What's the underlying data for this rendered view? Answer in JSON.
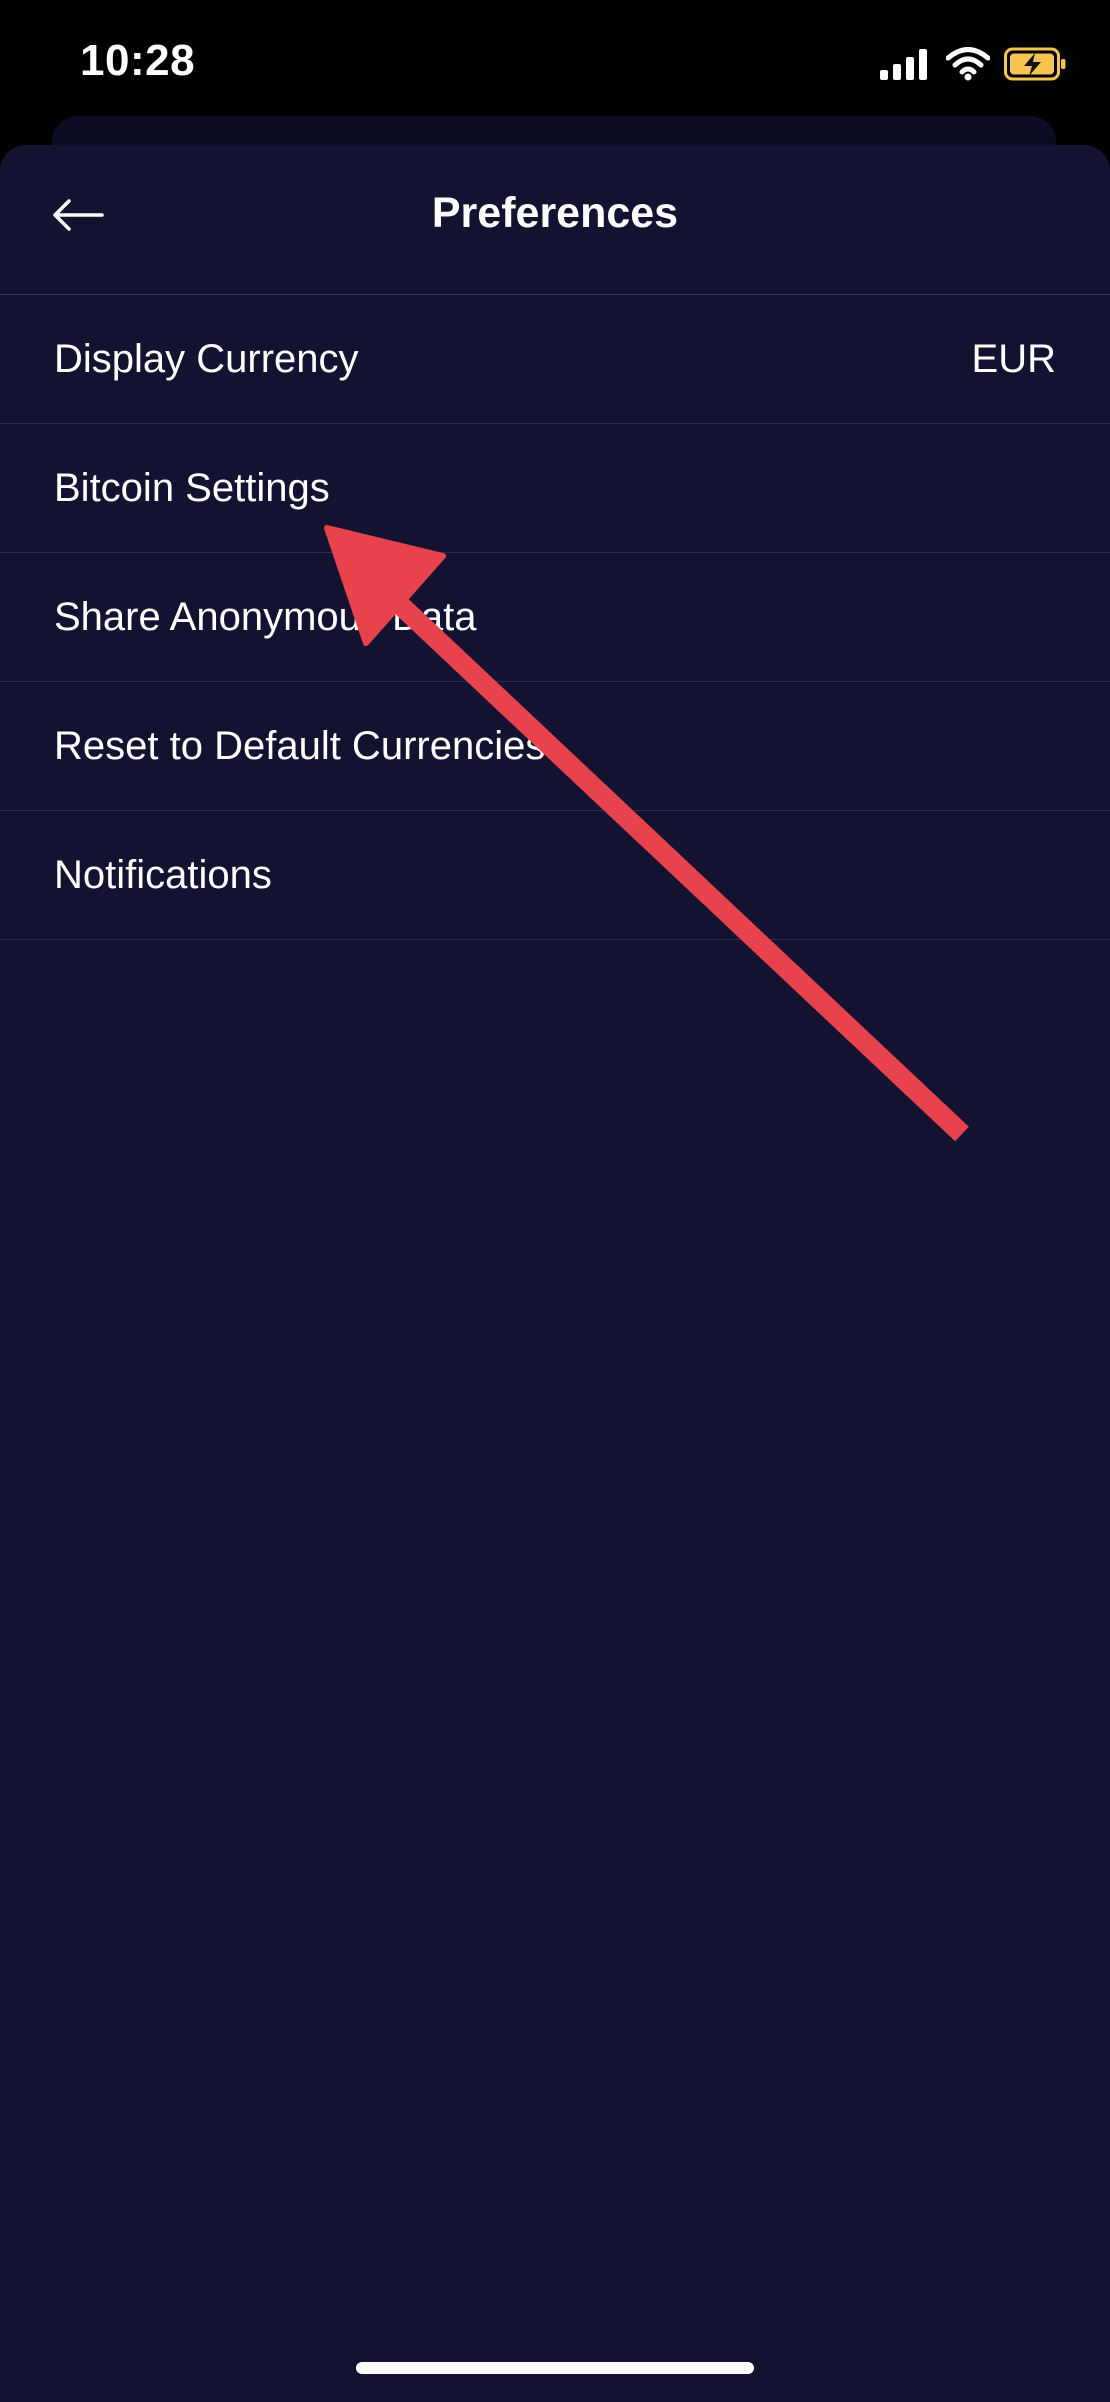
{
  "status_bar": {
    "time": "10:28",
    "icons": [
      "signal-icon",
      "wifi-icon",
      "battery-charging-icon"
    ],
    "battery_color": "#f5c451"
  },
  "header": {
    "title": "Preferences",
    "back_icon": "arrow-left-icon"
  },
  "menu": {
    "items": [
      {
        "label": "Display Currency",
        "value": "EUR"
      },
      {
        "label": "Bitcoin Settings",
        "value": ""
      },
      {
        "label": "Share Anonymous Data",
        "value": ""
      },
      {
        "label": "Reset to Default Currencies",
        "value": ""
      },
      {
        "label": "Notifications",
        "value": ""
      }
    ]
  },
  "annotation": {
    "type": "arrow",
    "color": "#e8424d",
    "points_to": "Bitcoin Settings"
  },
  "colors": {
    "background": "#131331",
    "divider": "#2c2c48",
    "text": "#ffffff"
  }
}
